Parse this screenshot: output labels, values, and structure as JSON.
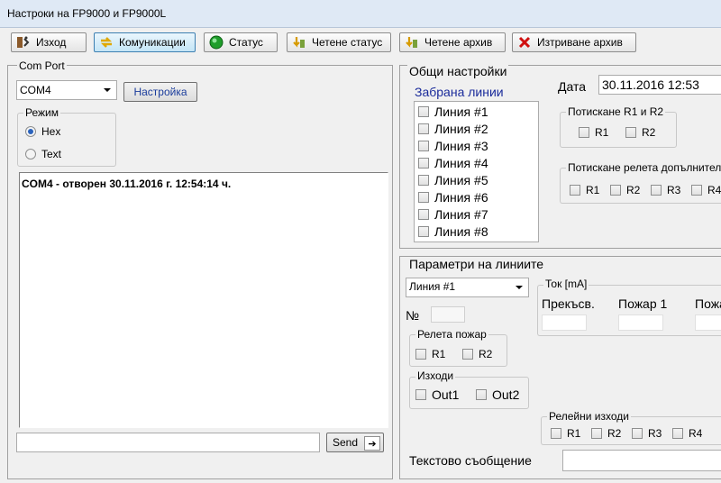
{
  "window": {
    "title": "Настроки на FP9000 и FP9000L"
  },
  "toolbar": {
    "exit": "Изход",
    "communications": "Комуникации",
    "status": "Статус",
    "read_status": "Четене статус",
    "read_archive": "Четене архив",
    "delete_archive": "Изтриване архив"
  },
  "com_port": {
    "caption": "Com Port",
    "selected": "COM4",
    "settings_button": "Настройка",
    "mode_caption": "Режим",
    "mode_hex": "Hex",
    "mode_text": "Text",
    "log_line": "COM4 - отворен 30.11.2016 г.  12:54:14 ч.",
    "send_button": "Send",
    "send_input_value": ""
  },
  "general": {
    "caption": "Общи настройки",
    "lines_caption": "Забрана линии",
    "lines": [
      "Линия #1",
      "Линия #2",
      "Линия #3",
      "Линия #4",
      "Линия #5",
      "Линия #6",
      "Линия #7",
      "Линия #8"
    ],
    "date_label": "Дата",
    "date_value": "30.11.2016  12:53",
    "press_r_caption": "Потискане R1 и R2",
    "press_r": [
      "R1",
      "R2"
    ],
    "extra_relays_caption": "Потискане релета допълнител",
    "extra_relays": [
      "R1",
      "R2",
      "R3",
      "R4"
    ]
  },
  "line_params": {
    "caption": "Параметри на линиите",
    "line_selected": "Линия #1",
    "number_label": "№",
    "fire_relays_caption": "Релета пожар",
    "fire_relays": [
      "R1",
      "R2"
    ],
    "outputs_caption": "Изходи",
    "outputs": [
      "Out1",
      "Out2"
    ],
    "current_caption": "Ток [mA]",
    "current_cols": [
      "Прекъсв.",
      "Пожар 1",
      "Пожа"
    ],
    "relay_outputs_caption": "Релейни изходи",
    "relay_outputs": [
      "R1",
      "R2",
      "R3",
      "R4"
    ],
    "text_message_label": "Текстово съобщение"
  }
}
